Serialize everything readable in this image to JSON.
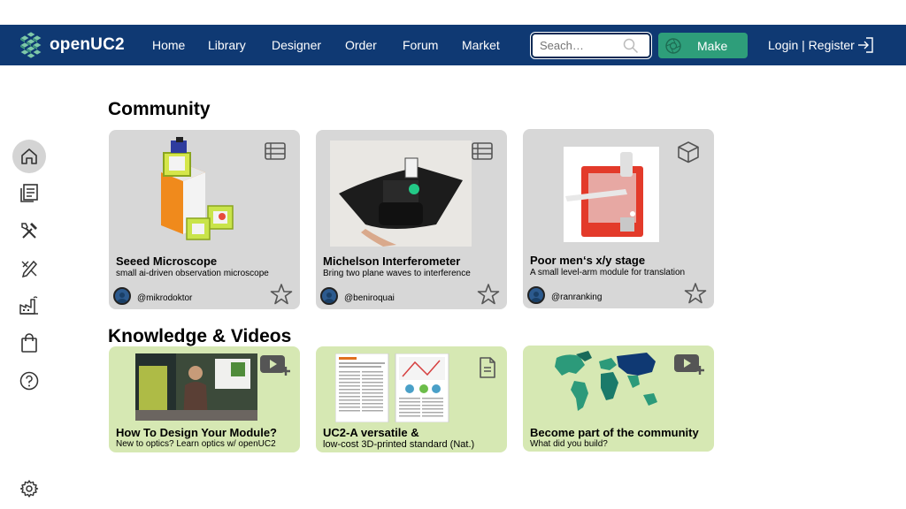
{
  "navbar": {
    "logo_text": "openUC2",
    "links": [
      "Home",
      "Library",
      "Designer",
      "Order",
      "Forum",
      "Market"
    ],
    "search_placeholder": "Seach…",
    "make_label": "Make",
    "login_label": "Login | Register",
    "background": "#0f3973",
    "make_color": "#2e9e7a"
  },
  "sidebar": {
    "icons": [
      "home-icon",
      "library-icon",
      "tools-icon",
      "designer-icon",
      "factory-icon",
      "shopping-bag-icon",
      "help-icon",
      "settings-icon"
    ]
  },
  "community": {
    "title": "Community",
    "cards": [
      {
        "title": "Seeed Microscope",
        "subtitle": "small ai-driven observation microscope",
        "author": "@mikrodoktor",
        "type_icon": "list-icon"
      },
      {
        "title": "Michelson Interferometer",
        "subtitle": "Bring two plane waves to interference",
        "author": "@beniroquai",
        "type_icon": "list-icon"
      },
      {
        "title": "Poor men‘s x/y stage",
        "subtitle": "A small level-arm module for translation",
        "author": "@ranranking",
        "type_icon": "cube-icon"
      }
    ]
  },
  "knowledge": {
    "title": "Knowledge & Videos",
    "cards": [
      {
        "title": "How To Design Your Module?",
        "subtitle": "New to optics? Learn optics w/ openUC2",
        "type_icon": "video-add-icon"
      },
      {
        "title": "UC2-A versatile &",
        "subtitle": "low-cost 3D-printed standard (Nat.)",
        "type_icon": "document-icon"
      },
      {
        "title": "Become part of the community",
        "subtitle": "What did you build?",
        "type_icon": "video-add-icon"
      }
    ]
  }
}
